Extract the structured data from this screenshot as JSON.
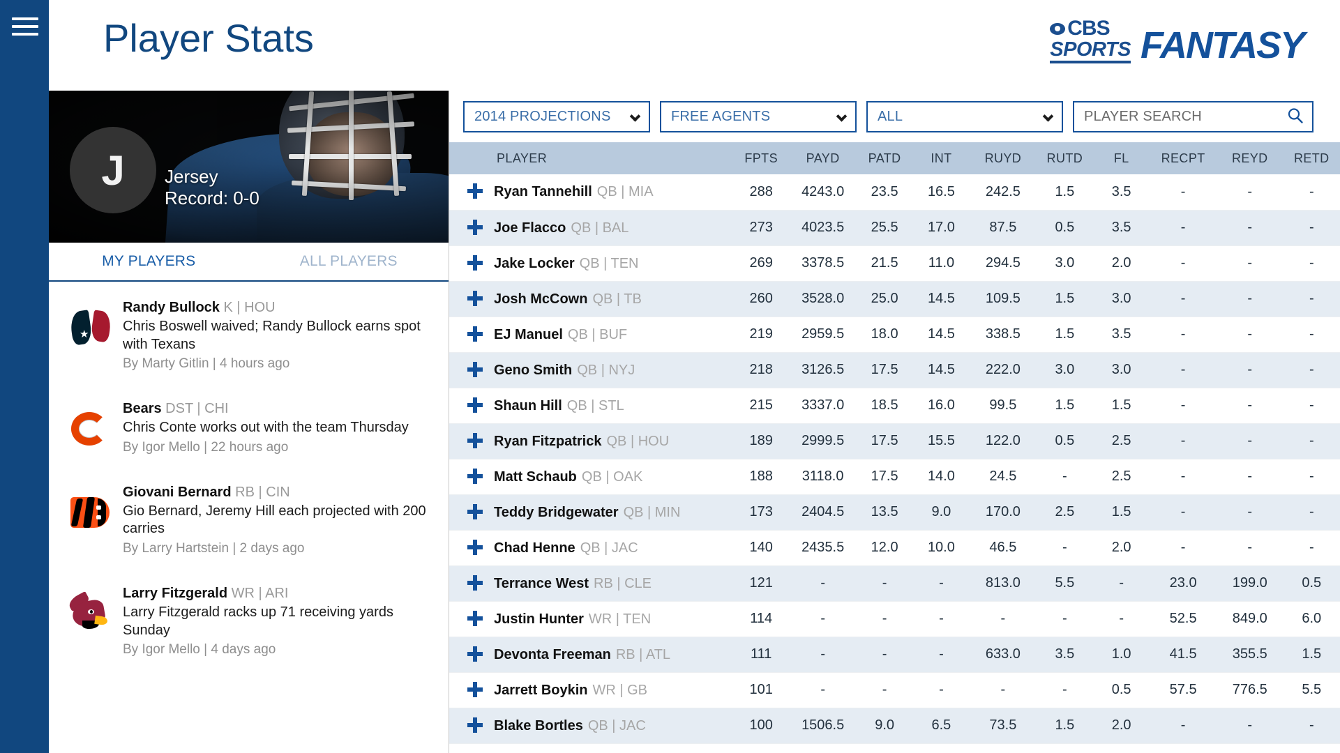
{
  "rail": {
    "menu_icon": "hamburger-icon"
  },
  "header": {
    "title": "Player Stats",
    "logo": {
      "cbs": "CBS",
      "sports": "SPORTS",
      "fantasy": "FANTASY"
    }
  },
  "left_panel": {
    "team": {
      "avatar_letter": "J",
      "name": "Jersey",
      "record": "Record: 0-0"
    },
    "tabs": [
      {
        "label": "MY PLAYERS",
        "active": true
      },
      {
        "label": "ALL PLAYERS",
        "active": false
      }
    ],
    "news": [
      {
        "logo": "texans-logo",
        "player": "Randy Bullock",
        "meta": "K | HOU",
        "headline": "Chris Boswell waived; Randy Bullock earns spot with Texans",
        "byline": "By Marty Gitlin | 4 hours ago"
      },
      {
        "logo": "bears-logo",
        "player": "Bears",
        "meta": "DST | CHI",
        "headline": "Chris Conte works out with the team Thursday",
        "byline": "By Igor Mello | 22 hours ago"
      },
      {
        "logo": "bengals-logo",
        "player": "Giovani Bernard",
        "meta": "RB | CIN",
        "headline": "Gio Bernard, Jeremy Hill each projected with 200 carries",
        "byline": "By Larry Hartstein | 2 days ago"
      },
      {
        "logo": "cardinals-logo",
        "player": "Larry Fitzgerald",
        "meta": "WR | ARI",
        "headline": "Larry Fitzgerald racks up 71 receiving yards Sunday",
        "byline": "By Igor Mello | 4 days ago"
      }
    ]
  },
  "filters": {
    "season": "2014 PROJECTIONS",
    "availability": "FREE AGENTS",
    "position": "ALL",
    "search_placeholder": "PLAYER SEARCH",
    "search_value": ""
  },
  "table": {
    "columns": [
      "PLAYER",
      "FPTS",
      "PAYD",
      "PATD",
      "INT",
      "RUYD",
      "RUTD",
      "FL",
      "RECPT",
      "REYD",
      "RETD"
    ],
    "rows": [
      {
        "name": "Ryan Tannehill",
        "meta": "QB | MIA",
        "fpts": "288",
        "payd": "4243.0",
        "patd": "23.5",
        "int": "16.5",
        "ruyd": "242.5",
        "rutd": "1.5",
        "fl": "3.5",
        "recpt": "-",
        "reyd": "-",
        "retd": "-"
      },
      {
        "name": "Joe Flacco",
        "meta": "QB | BAL",
        "fpts": "273",
        "payd": "4023.5",
        "patd": "25.5",
        "int": "17.0",
        "ruyd": "87.5",
        "rutd": "0.5",
        "fl": "3.5",
        "recpt": "-",
        "reyd": "-",
        "retd": "-"
      },
      {
        "name": "Jake Locker",
        "meta": "QB | TEN",
        "fpts": "269",
        "payd": "3378.5",
        "patd": "21.5",
        "int": "11.0",
        "ruyd": "294.5",
        "rutd": "3.0",
        "fl": "2.0",
        "recpt": "-",
        "reyd": "-",
        "retd": "-"
      },
      {
        "name": "Josh McCown",
        "meta": "QB | TB",
        "fpts": "260",
        "payd": "3528.0",
        "patd": "25.0",
        "int": "14.5",
        "ruyd": "109.5",
        "rutd": "1.5",
        "fl": "3.0",
        "recpt": "-",
        "reyd": "-",
        "retd": "-"
      },
      {
        "name": "EJ Manuel",
        "meta": "QB | BUF",
        "fpts": "219",
        "payd": "2959.5",
        "patd": "18.0",
        "int": "14.5",
        "ruyd": "338.5",
        "rutd": "1.5",
        "fl": "3.5",
        "recpt": "-",
        "reyd": "-",
        "retd": "-"
      },
      {
        "name": "Geno Smith",
        "meta": "QB | NYJ",
        "fpts": "218",
        "payd": "3126.5",
        "patd": "17.5",
        "int": "14.5",
        "ruyd": "222.0",
        "rutd": "3.0",
        "fl": "3.0",
        "recpt": "-",
        "reyd": "-",
        "retd": "-"
      },
      {
        "name": "Shaun Hill",
        "meta": "QB | STL",
        "fpts": "215",
        "payd": "3337.0",
        "patd": "18.5",
        "int": "16.0",
        "ruyd": "99.5",
        "rutd": "1.5",
        "fl": "1.5",
        "recpt": "-",
        "reyd": "-",
        "retd": "-"
      },
      {
        "name": "Ryan Fitzpatrick",
        "meta": "QB | HOU",
        "fpts": "189",
        "payd": "2999.5",
        "patd": "17.5",
        "int": "15.5",
        "ruyd": "122.0",
        "rutd": "0.5",
        "fl": "2.5",
        "recpt": "-",
        "reyd": "-",
        "retd": "-"
      },
      {
        "name": "Matt Schaub",
        "meta": "QB | OAK",
        "fpts": "188",
        "payd": "3118.0",
        "patd": "17.5",
        "int": "14.0",
        "ruyd": "24.5",
        "rutd": "-",
        "fl": "2.5",
        "recpt": "-",
        "reyd": "-",
        "retd": "-"
      },
      {
        "name": "Teddy Bridgewater",
        "meta": "QB | MIN",
        "fpts": "173",
        "payd": "2404.5",
        "patd": "13.5",
        "int": "9.0",
        "ruyd": "170.0",
        "rutd": "2.5",
        "fl": "1.5",
        "recpt": "-",
        "reyd": "-",
        "retd": "-"
      },
      {
        "name": "Chad Henne",
        "meta": "QB | JAC",
        "fpts": "140",
        "payd": "2435.5",
        "patd": "12.0",
        "int": "10.0",
        "ruyd": "46.5",
        "rutd": "-",
        "fl": "2.0",
        "recpt": "-",
        "reyd": "-",
        "retd": "-"
      },
      {
        "name": "Terrance West",
        "meta": "RB | CLE",
        "fpts": "121",
        "payd": "-",
        "patd": "-",
        "int": "-",
        "ruyd": "813.0",
        "rutd": "5.5",
        "fl": "-",
        "recpt": "23.0",
        "reyd": "199.0",
        "retd": "0.5"
      },
      {
        "name": "Justin Hunter",
        "meta": "WR | TEN",
        "fpts": "114",
        "payd": "-",
        "patd": "-",
        "int": "-",
        "ruyd": "-",
        "rutd": "-",
        "fl": "-",
        "recpt": "52.5",
        "reyd": "849.0",
        "retd": "6.0"
      },
      {
        "name": "Devonta Freeman",
        "meta": "RB | ATL",
        "fpts": "111",
        "payd": "-",
        "patd": "-",
        "int": "-",
        "ruyd": "633.0",
        "rutd": "3.5",
        "fl": "1.0",
        "recpt": "41.5",
        "reyd": "355.5",
        "retd": "1.5"
      },
      {
        "name": "Jarrett Boykin",
        "meta": "WR | GB",
        "fpts": "101",
        "payd": "-",
        "patd": "-",
        "int": "-",
        "ruyd": "-",
        "rutd": "-",
        "fl": "0.5",
        "recpt": "57.5",
        "reyd": "776.5",
        "retd": "5.5"
      },
      {
        "name": "Blake Bortles",
        "meta": "QB | JAC",
        "fpts": "100",
        "payd": "1506.5",
        "patd": "9.0",
        "int": "6.5",
        "ruyd": "73.5",
        "rutd": "1.5",
        "fl": "2.0",
        "recpt": "-",
        "reyd": "-",
        "retd": "-"
      }
    ]
  },
  "colors": {
    "rail_blue": "#11477f",
    "accent_blue": "#14519b",
    "header_row": "#b8cadd",
    "alt_row": "#e5ecf3"
  }
}
